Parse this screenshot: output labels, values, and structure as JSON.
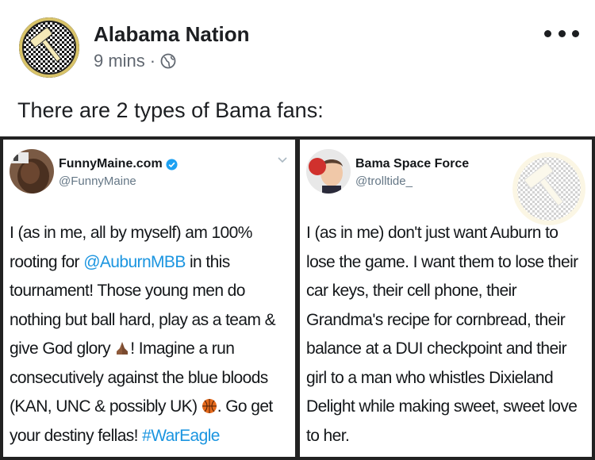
{
  "post": {
    "page_name": "Alabama Nation",
    "time": "9 mins",
    "separator": "·",
    "text": "There are 2 types of Bama fans:"
  },
  "icons": {
    "avatar": "alabama-nation-logo",
    "privacy": "globe-icon",
    "more": "more-options-icon",
    "verified": "verified-badge-icon",
    "caret": "chevron-down-icon"
  },
  "tweets": [
    {
      "name": "FunnyMaine.com",
      "handle": "@FunnyMaine",
      "verified": true,
      "body": {
        "p1": "I (as in me, all by myself) am 100% rooting for ",
        "mention": "@AuburnMBB",
        "p2": " in this tournament! Those young men do nothing but ball hard, play as a team & give God glory ",
        "p3": "! Imagine a run consecutively against the blue bloods (KAN, UNC & possibly UK) ",
        "p4": ". Go get your destiny fellas! ",
        "hashtag": "#WarEagle"
      }
    },
    {
      "name": "Bama Space Force",
      "handle": "@trolltide_",
      "verified": false,
      "body": {
        "text": "I (as in me) don't just want Auburn to lose the game. I want them to lose their car keys, their cell phone, their Grandma's recipe for cornbread, their balance at a DUI checkpoint and their girl to a man who whistles Dixieland Delight while making sweet, sweet love to her."
      }
    }
  ],
  "colors": {
    "link": "#1b95e0",
    "frame": "#222222",
    "crimson": "#d0312d",
    "gold": "#f1e2a1"
  }
}
